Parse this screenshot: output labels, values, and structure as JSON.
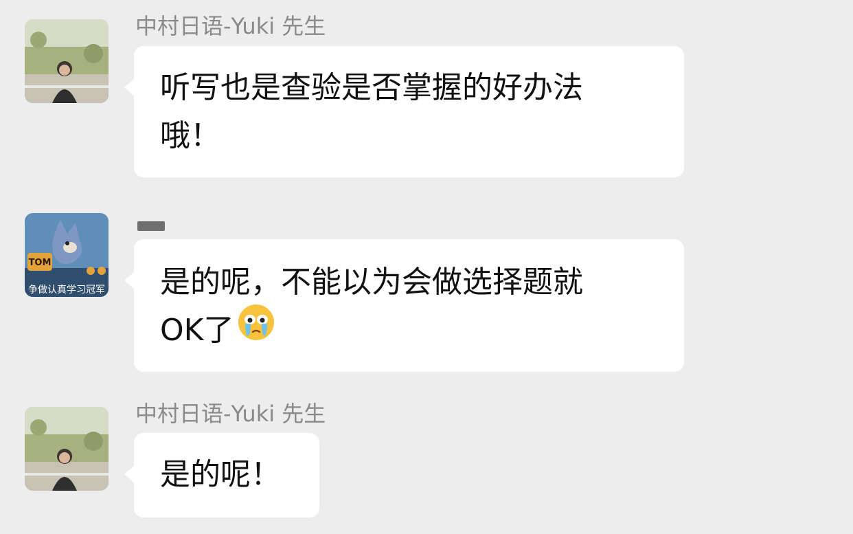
{
  "messages": [
    {
      "sender": "中村日语-Yuki 先生",
      "avatar": "teacher-photo-avatar",
      "lines": [
        "听写也是查验是否掌握的好办法",
        "哦！"
      ]
    },
    {
      "sender": "",
      "avatar": "tom-cat-avatar",
      "avatar_text": "TOM",
      "avatar_caption": "争做认真学习冠军",
      "lines": [
        "是的呢，不能以为会做选择题就",
        "OK了"
      ],
      "emoji": "crying-face-emoji"
    },
    {
      "sender": "中村日语-Yuki 先生",
      "avatar": "teacher-photo-avatar",
      "lines": [
        "是的呢！"
      ]
    }
  ]
}
